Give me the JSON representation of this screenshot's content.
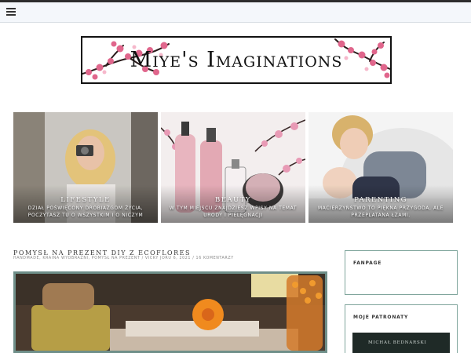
{
  "header": {
    "menu_icon": "hamburger-menu-icon",
    "logo_text": "Miye's Imaginations",
    "accent_color": "#2d2d2d"
  },
  "categories": [
    {
      "title": "LIFESTYLE",
      "description": "DZIAŁ POŚWIĘCONY DROBIAZGOM ŻYCIA, POCZYTASZ TU O WSZYSTKIM I O NICZYM"
    },
    {
      "title": "BEAUTY",
      "description": "W TYM MIEJSCU ZNAJDZIESZ WPISY NA TEMAT URODY I PIELĘGNACJI"
    },
    {
      "title": "PARENTING",
      "description": "MACIERZYŃSTWO TO PIĘKNA PRZYGODA, ALE PRZEPLATANA ŁZAMI."
    }
  ],
  "post": {
    "title": "POMYSŁ NA PREZENT DIY Z ECOFLORES",
    "meta": "HANDMADE, KRAINA WYOBRAŹNI, POMYSŁ NA PREZENT / VICKY JORU 6, 2021 / 16 KOMENTARZY"
  },
  "sidebar": {
    "fanpage_title": "FANPAGE",
    "patronaty_title": "MOJE PATRONATY",
    "patron_name": "MICHAŁ BEDNARSKI",
    "border_color": "#7fa59c"
  }
}
